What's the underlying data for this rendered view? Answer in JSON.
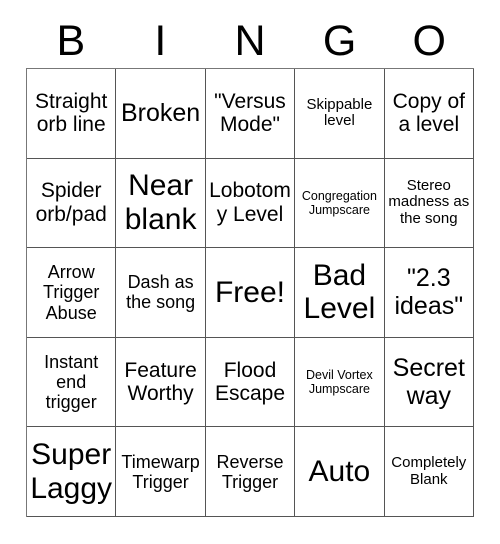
{
  "card": {
    "header_letters": [
      "B",
      "I",
      "N",
      "G",
      "O"
    ],
    "rows": [
      [
        {
          "text": "Straight orb line",
          "size": "lg"
        },
        {
          "text": "Broken",
          "size": "xl"
        },
        {
          "text": "\"Versus Mode\"",
          "size": "lg"
        },
        {
          "text": "Skippable level",
          "size": "sm"
        },
        {
          "text": "Copy of a level",
          "size": "lg"
        }
      ],
      [
        {
          "text": "Spider orb/pad",
          "size": "lg"
        },
        {
          "text": "Near blank",
          "size": "xxl"
        },
        {
          "text": "Lobotomy Level",
          "size": "lg"
        },
        {
          "text": "Congregation Jumpscare",
          "size": "xs"
        },
        {
          "text": "Stereo madness as the song",
          "size": "sm"
        }
      ],
      [
        {
          "text": "Arrow Trigger Abuse",
          "size": "md"
        },
        {
          "text": "Dash as the song",
          "size": "md"
        },
        {
          "text": "Free!",
          "size": "xxl"
        },
        {
          "text": "Bad Level",
          "size": "xxl"
        },
        {
          "text": "\"2.3 ideas\"",
          "size": "xl"
        }
      ],
      [
        {
          "text": "Instant end trigger",
          "size": "md"
        },
        {
          "text": "Feature Worthy",
          "size": "lg"
        },
        {
          "text": "Flood Escape",
          "size": "lg"
        },
        {
          "text": "Devil Vortex Jumpscare",
          "size": "xs"
        },
        {
          "text": "Secret way",
          "size": "xl"
        }
      ],
      [
        {
          "text": "Super Laggy",
          "size": "xxl"
        },
        {
          "text": "Timewarp Trigger",
          "size": "md"
        },
        {
          "text": "Reverse Trigger",
          "size": "md"
        },
        {
          "text": "Auto",
          "size": "xxl"
        },
        {
          "text": "Completely Blank",
          "size": "sm"
        }
      ]
    ]
  },
  "colors": {
    "background": "#ffffff",
    "text": "#000000",
    "grid_line": "#555555"
  }
}
